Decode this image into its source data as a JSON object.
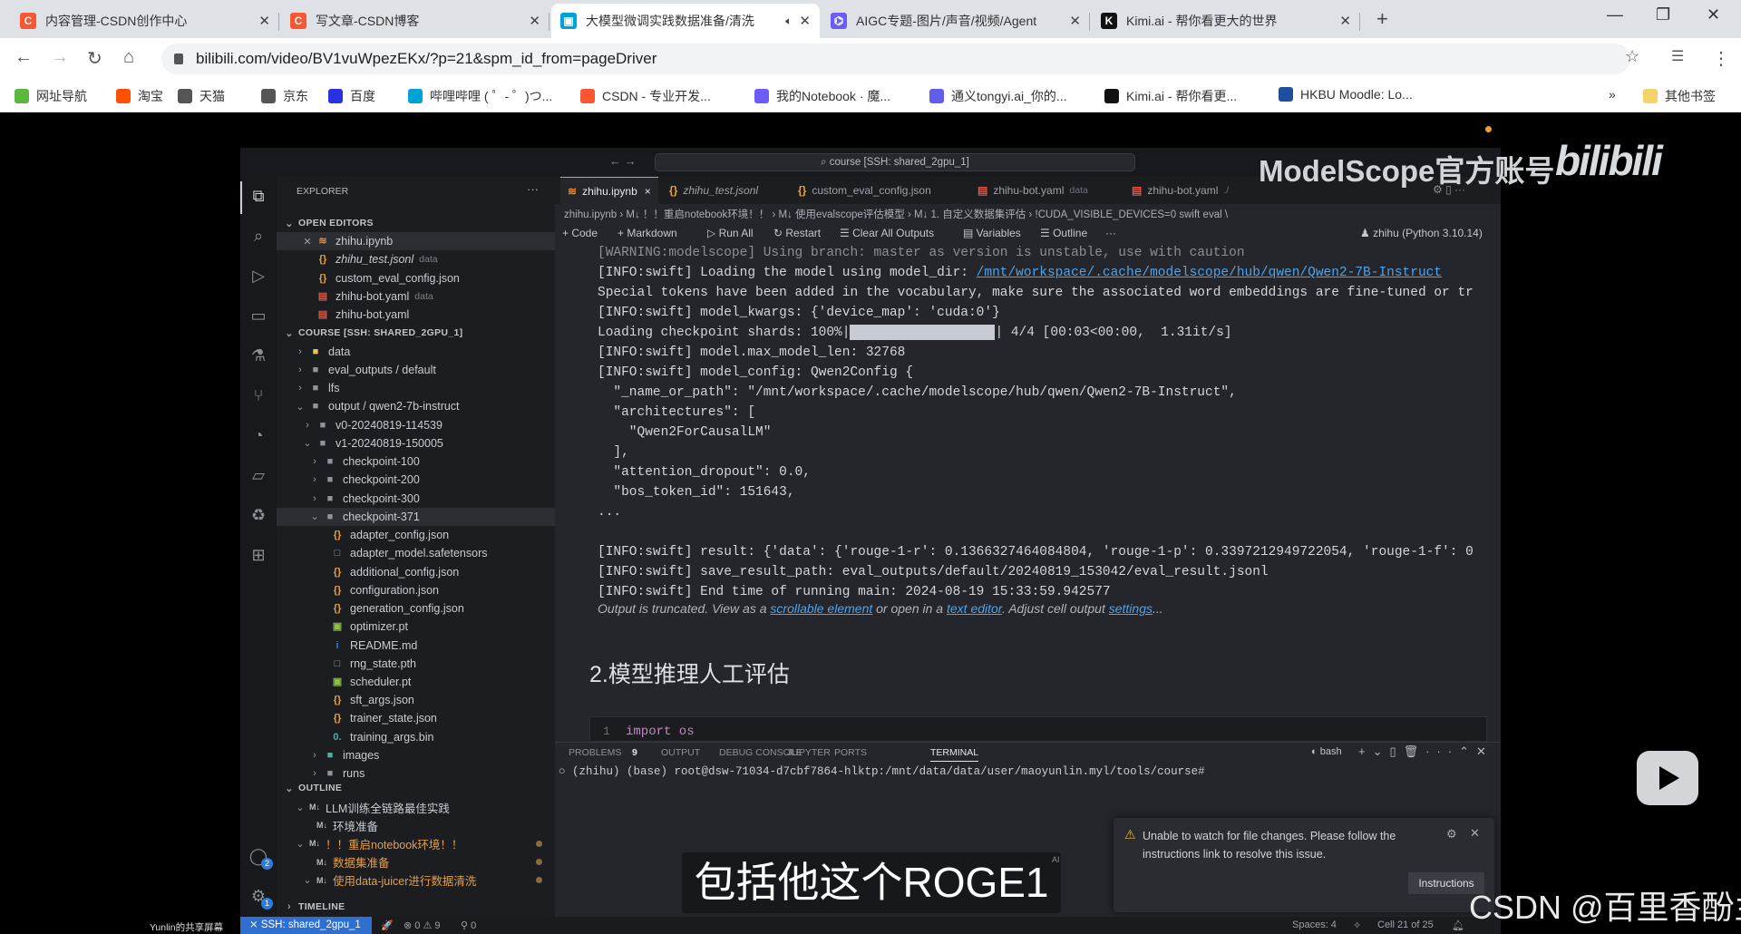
{
  "browser": {
    "tabs": [
      {
        "title": "内容管理-CSDN创作中心",
        "icon": "csdn-icon",
        "color": "#fc5531",
        "letter": "C"
      },
      {
        "title": "写文章-CSDN博客",
        "icon": "csdn-icon",
        "color": "#fc5531",
        "letter": "C"
      },
      {
        "title": "大模型微调实践数据准备/清洗",
        "icon": "bilibili-icon",
        "color": "#00a1d6",
        "letter": "▣",
        "active": true,
        "audio": true
      },
      {
        "title": "AIGC专题-图片/声音/视频/Agent",
        "icon": "aigc-icon",
        "color": "#6b5cf6",
        "letter": "⌬"
      },
      {
        "title": "Kimi.ai - 帮你看更大的世界",
        "icon": "kimi-icon",
        "color": "#111111",
        "letter": "K"
      }
    ],
    "url": "bilibili.com/video/BV1vuWpezEKx/?p=21&spm_id_from=pageDriver",
    "bookmarks": [
      {
        "label": "网址导航",
        "color": "#5bb83c"
      },
      {
        "label": "淘宝",
        "color": "#ff5000"
      },
      {
        "label": "天猫",
        "color": "#555555"
      },
      {
        "label": "京东",
        "color": "#555555"
      },
      {
        "label": "百度",
        "color": "#2932e1"
      },
      {
        "label": "哔哩哔哩 ( ゜- ゜)つ...",
        "color": "#00a1d6"
      },
      {
        "label": "CSDN - 专业开发...",
        "color": "#fc5531"
      },
      {
        "label": "我的Notebook · 魔...",
        "color": "#6b5cf6"
      },
      {
        "label": "通义tongyi.ai_你的...",
        "color": "#615ced"
      },
      {
        "label": "Kimi.ai - 帮你看更...",
        "color": "#111111"
      },
      {
        "label": "HKBU Moodle: Lo...",
        "color": "#1e4e9c"
      }
    ],
    "other_bookmarks": "其他书签",
    "more": "»"
  },
  "vscode": {
    "command_center": "course [SSH: shared_2gpu_1]",
    "sidebar": {
      "title": "EXPLORER",
      "rows": [
        {
          "label": "OPEN EDITORS",
          "type": "header",
          "depth": 0,
          "open": true
        },
        {
          "label": "zhihu.ipynb",
          "type": "ipynb",
          "depth": 2,
          "selected": true,
          "close": true
        },
        {
          "label": "zhihu_test.jsonl",
          "hint": "data",
          "type": "json",
          "depth": 2,
          "italic": true
        },
        {
          "label": "custom_eval_config.json",
          "type": "json",
          "depth": 2
        },
        {
          "label": "zhihu-bot.yaml",
          "hint": "data",
          "type": "yaml",
          "depth": 2
        },
        {
          "label": "zhihu-bot.yaml",
          "type": "yaml",
          "depth": 2
        },
        {
          "label": "COURSE [SSH: SHARED_2GPU_1]",
          "type": "header",
          "depth": 0,
          "open": true
        },
        {
          "label": "data",
          "type": "folder-data",
          "depth": 1,
          "chev": ">"
        },
        {
          "label": "eval_outputs / default",
          "type": "folder",
          "depth": 1,
          "chev": ">"
        },
        {
          "label": "lfs",
          "type": "folder",
          "depth": 1,
          "chev": ">"
        },
        {
          "label": "output / qwen2-7b-instruct",
          "type": "folder",
          "depth": 1,
          "chev": "v"
        },
        {
          "label": "v0-20240819-114539",
          "type": "folder",
          "depth": 2,
          "chev": ">"
        },
        {
          "label": "v1-20240819-150005",
          "type": "folder",
          "depth": 2,
          "chev": "v"
        },
        {
          "label": "checkpoint-100",
          "type": "folder",
          "depth": 3,
          "chev": ">"
        },
        {
          "label": "checkpoint-200",
          "type": "folder",
          "depth": 3,
          "chev": ">"
        },
        {
          "label": "checkpoint-300",
          "type": "folder",
          "depth": 3,
          "chev": ">"
        },
        {
          "label": "checkpoint-371",
          "type": "folder",
          "depth": 3,
          "chev": "v",
          "selected": true
        },
        {
          "label": "adapter_config.json",
          "type": "json",
          "depth": 4
        },
        {
          "label": "adapter_model.safetensors",
          "type": "file",
          "depth": 4
        },
        {
          "label": "additional_config.json",
          "type": "json",
          "depth": 4
        },
        {
          "label": "configuration.json",
          "type": "json",
          "depth": 4
        },
        {
          "label": "generation_config.json",
          "type": "json",
          "depth": 4
        },
        {
          "label": "optimizer.pt",
          "type": "pt",
          "depth": 4
        },
        {
          "label": "README.md",
          "type": "info",
          "depth": 4
        },
        {
          "label": "rng_state.pth",
          "type": "file",
          "depth": 4
        },
        {
          "label": "scheduler.pt",
          "type": "pt",
          "depth": 4
        },
        {
          "label": "sft_args.json",
          "type": "json",
          "depth": 4
        },
        {
          "label": "trainer_state.json",
          "type": "json",
          "depth": 4
        },
        {
          "label": "training_args.bin",
          "type": "bin",
          "depth": 4
        },
        {
          "label": "images",
          "type": "folder-img",
          "depth": 3,
          "chev": ">"
        },
        {
          "label": "runs",
          "type": "folder",
          "depth": 3,
          "chev": ">"
        }
      ],
      "outline_title": "OUTLINE",
      "outline": [
        {
          "label": "LLM训练全链路最佳实践",
          "depth": 1,
          "chev": "v"
        },
        {
          "label": "环境准备",
          "depth": 2
        },
        {
          "label": "！！重启notebook环境！！",
          "depth": 1,
          "chev": "v",
          "modified": true
        },
        {
          "label": "数据集准备",
          "depth": 2,
          "modified": true
        },
        {
          "label": "使用data-juicer进行数据清洗",
          "depth": 2,
          "chev": "v",
          "modified": true
        }
      ],
      "timeline_title": "TIMELINE"
    },
    "editor_tabs": [
      {
        "label": "zhihu.ipynb",
        "type": "ipynb",
        "active": true,
        "close": "×"
      },
      {
        "label": "zhihu_test.jsonl",
        "type": "json",
        "italic": true
      },
      {
        "label": "custom_eval_config.json",
        "type": "json"
      },
      {
        "label": "zhihu-bot.yaml",
        "hint": "data",
        "type": "yaml"
      },
      {
        "label": "zhihu-bot.yaml",
        "hint": "./",
        "type": "yaml"
      }
    ],
    "breadcrumb": "zhihu.ipynb › M↓ ！！重启notebook环境！！ › M↓ 使用evalscope评估模型 › M↓ 1. 自定义数据集评估 › !CUDA_VISIBLE_DEVICES=0 swift eval \\",
    "toolbar": {
      "code": "+ Code",
      "markdown": "+ Markdown",
      "run_all": "▷ Run All",
      "restart": "↻ Restart",
      "clear": "☰ Clear All Outputs",
      "variables": "▤ Variables",
      "outline": "☰ Outline",
      "more": "···",
      "kernel": "zhihu (Python 3.10.14)"
    },
    "output_lines": [
      "[WARNING:modelscope] Using branch: master as version is unstable, use with caution",
      "[INFO:swift] Loading the model using model_dir: ",
      "Special tokens have been added in the vocabulary, make sure the associated word embeddings are fine-tuned or tr",
      "[INFO:swift] model_kwargs: {'device_map': 'cuda:0'}",
      "Loading checkpoint shards: 100%|",
      "[INFO:swift] model.max_model_len: 32768",
      "[INFO:swift] model_config: Qwen2Config {",
      "  \"_name_or_path\": \"/mnt/workspace/.cache/modelscope/hub/qwen/Qwen2-7B-Instruct\",",
      "  \"architectures\": [",
      "    \"Qwen2ForCausalLM\"",
      "  ],",
      "  \"attention_dropout\": 0.0,",
      "  \"bos_token_id\": 151643,",
      "...",
      "",
      "[INFO:swift] result: {'data': {'rouge-1-r': 0.1366327464084804, 'rouge-1-p': 0.3397212949722054, 'rouge-1-f': 0",
      "[INFO:swift] save_result_path: eval_outputs/default/20240819_153042/eval_result.jsonl",
      "[INFO:swift] End time of running main: 2024-08-19 15:33:59.942577"
    ],
    "model_dir_link": "/mnt/workspace/.cache/modelscope/hub/qwen/Qwen2-7B-Instruct",
    "progress": {
      "percent": 100,
      "suffix": "| 4/4 [00:03<00:00,  1.31it/s]"
    },
    "truncated": {
      "a": "Output is truncated. View as a ",
      "link1": "scrollable element",
      "b": " or open in a ",
      "link2": "text editor",
      "c": ". Adjust cell output ",
      "link3": "settings",
      "d": "..."
    },
    "heading": "2.模型推理人工评估",
    "code_line_no": "1",
    "code": "import os",
    "panel_tabs": [
      {
        "label": "PROBLEMS"
      },
      {
        "label": "9"
      },
      {
        "label": "OUTPUT"
      },
      {
        "label": "DEBUG CONSOLE"
      },
      {
        "label": "JUPYTER"
      },
      {
        "label": "PORTS"
      },
      {
        "label": "TERMINAL",
        "active": true
      }
    ],
    "terminal_shell": "bash",
    "terminal_line": "○ (zhihu) (base) root@dsw-71034-d7cbf7864-hlktp:/mnt/data/data/user/maoyunlin.myl/tools/course#",
    "notification": {
      "message": "Unable to watch for file changes. Please follow the instructions link to resolve this issue.",
      "button": "Instructions"
    },
    "status": {
      "remote": "SSH: shared_2gpu_1",
      "errors": "0",
      "warnings": "9",
      "ports": "0",
      "spaces": "Spaces: 4",
      "cell": "Cell 21 of 25"
    },
    "activity_badges": {
      "accounts": "2",
      "settings": "1"
    }
  },
  "video": {
    "subtitle": "包括他这个ROGE1",
    "watermark": "ModelScope官方账号",
    "logo": "bilibili",
    "csdn_watermark": "CSDN @百里香酚兰",
    "sharer": "Yunlin的共享屏幕",
    "ai_tag": "AI"
  }
}
